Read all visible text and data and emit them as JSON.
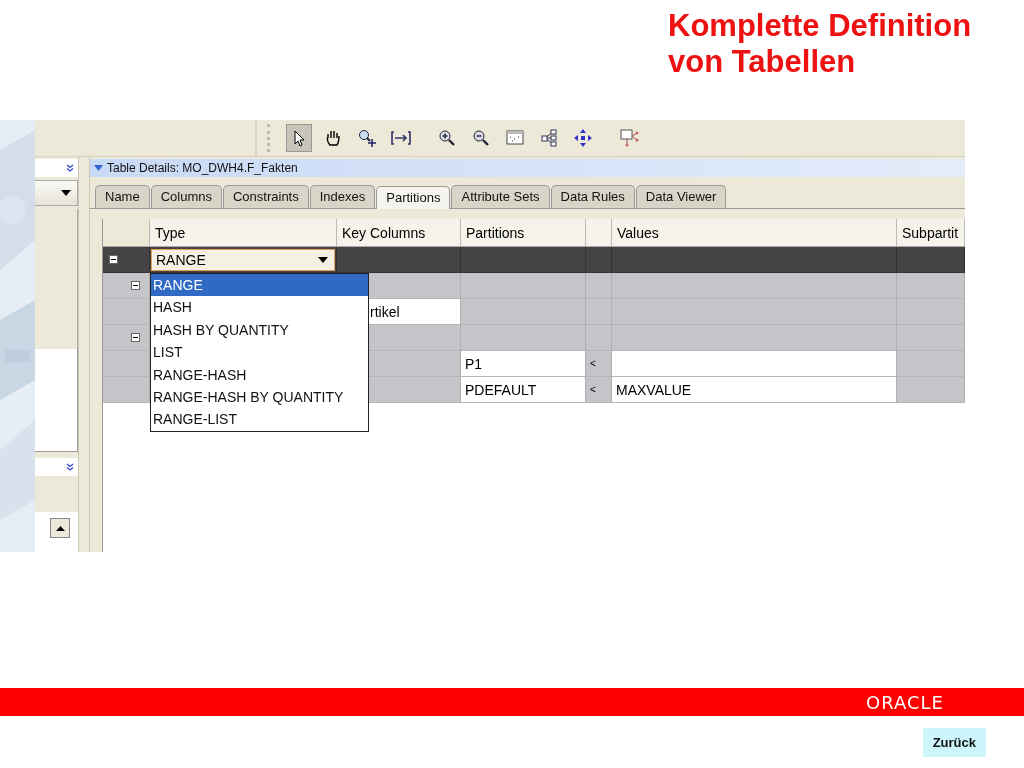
{
  "slide_title": "Komplette Definition von Tabellen",
  "toolbar": [
    {
      "kind": "pointer",
      "selected": true
    },
    {
      "kind": "hand",
      "selected": false
    },
    {
      "kind": "zoom-area",
      "selected": false
    },
    {
      "kind": "fit",
      "selected": false
    },
    {
      "kind": "zoom-in",
      "selected": false
    },
    {
      "kind": "zoom-out",
      "selected": false
    },
    {
      "kind": "overview",
      "selected": false
    },
    {
      "kind": "tree",
      "selected": false
    },
    {
      "kind": "move",
      "selected": false
    },
    {
      "kind": "graph",
      "selected": false
    }
  ],
  "panel_title": "Table Details: MO_DWH4.F_Fakten",
  "tabs": [
    {
      "label": "Name",
      "selected": false
    },
    {
      "label": "Columns",
      "selected": false
    },
    {
      "label": "Constraints",
      "selected": false
    },
    {
      "label": "Indexes",
      "selected": false
    },
    {
      "label": "Partitions",
      "selected": true
    },
    {
      "label": "Attribute Sets",
      "selected": false
    },
    {
      "label": "Data Rules",
      "selected": false
    },
    {
      "label": "Data Viewer",
      "selected": false
    }
  ],
  "table": {
    "columns": [
      "Type",
      "Key Columns",
      "Partitions",
      "Values",
      "Subpartit"
    ],
    "rows": [
      {
        "kind": "type",
        "type": "RANGE",
        "expanded": true,
        "children": [
          {
            "kind": "group",
            "expanded": true,
            "children": [
              {
                "kind": "key",
                "key_column": "rtikel"
              }
            ]
          },
          {
            "kind": "group",
            "expanded": true,
            "children": [
              {
                "kind": "partition",
                "partition": "P1",
                "operator": "<"
              },
              {
                "kind": "partition",
                "partition": "PDEFAULT",
                "operator": "<",
                "value": "MAXVALUE"
              }
            ]
          }
        ]
      }
    ]
  },
  "type_dropdown": {
    "options": [
      {
        "label": "RANGE",
        "selected": true
      },
      {
        "label": "HASH",
        "selected": false
      },
      {
        "label": "HASH BY QUANTITY",
        "selected": false
      },
      {
        "label": "LIST",
        "selected": false
      },
      {
        "label": "RANGE-HASH",
        "selected": false
      },
      {
        "label": "RANGE-HASH BY QUANTITY",
        "selected": false
      },
      {
        "label": "RANGE-LIST",
        "selected": false
      }
    ]
  },
  "logo": "ORACLE",
  "back_button": "Zurück"
}
